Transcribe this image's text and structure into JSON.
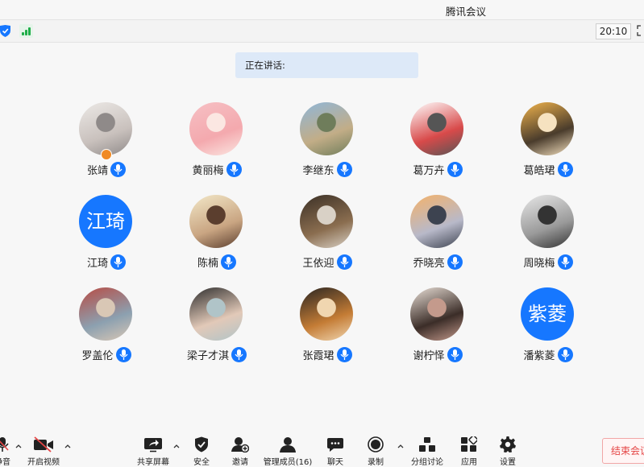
{
  "window": {
    "title": "腾讯会议"
  },
  "status": {
    "clock": "20:10"
  },
  "speaking": {
    "label": "正在讲话:"
  },
  "participants": [
    {
      "name": "张靖",
      "type": "photo",
      "palette": [
        "#ece9e6",
        "#c9c1bd",
        "#8f8a89"
      ],
      "host": true
    },
    {
      "name": "黄丽梅",
      "type": "photo",
      "palette": [
        "#f6c0c4",
        "#f4a9ae",
        "#fbe7e2"
      ]
    },
    {
      "name": "李继东",
      "type": "photo",
      "palette": [
        "#8fb6d8",
        "#c2ad87",
        "#6f7d5b"
      ]
    },
    {
      "name": "葛万卉",
      "type": "photo",
      "palette": [
        "#ffffff",
        "#d84a4a",
        "#555555"
      ]
    },
    {
      "name": "葛皓珺",
      "type": "photo",
      "palette": [
        "#f2b44c",
        "#4a3c2c",
        "#f6e2c0"
      ]
    },
    {
      "name": "江琦",
      "type": "letter",
      "initials": "江琦"
    },
    {
      "name": "陈楠",
      "type": "photo",
      "palette": [
        "#f3e8c8",
        "#c9a582",
        "#5b3e2e"
      ]
    },
    {
      "name": "王依迎",
      "type": "photo",
      "palette": [
        "#3b3026",
        "#8a6d4f",
        "#d9d1c6"
      ]
    },
    {
      "name": "乔晓亮",
      "type": "photo",
      "palette": [
        "#f4b26b",
        "#b8b9c9",
        "#3d4350"
      ]
    },
    {
      "name": "周晓梅",
      "type": "photo",
      "palette": [
        "#e8e8e8",
        "#9a9a9a",
        "#333333"
      ]
    },
    {
      "name": "罗盖伦",
      "type": "photo",
      "palette": [
        "#b84c44",
        "#8ca0b0",
        "#d9c7b5"
      ]
    },
    {
      "name": "梁子才淇",
      "type": "photo",
      "palette": [
        "#2e2e2e",
        "#e2c9b8",
        "#b0c4c8"
      ]
    },
    {
      "name": "张霞珺",
      "type": "photo",
      "palette": [
        "#2a2622",
        "#c47c35",
        "#f0d6b0"
      ]
    },
    {
      "name": "谢柠怿",
      "type": "photo",
      "palette": [
        "#e9dfd6",
        "#3b2d28",
        "#c49a8c"
      ]
    },
    {
      "name": "潘紫菱",
      "type": "letter",
      "initials": "紫菱"
    }
  ],
  "toolbar": {
    "mute": "静音",
    "video": "开启视频",
    "share": "共享屏幕",
    "security": "安全",
    "invite": "邀请",
    "members": "管理成员(16)",
    "chat": "聊天",
    "record": "录制",
    "breakout": "分组讨论",
    "apps": "应用",
    "settings": "设置",
    "end": "结束会议"
  },
  "colors": {
    "accent": "#1677ff",
    "end": "#e54545",
    "signal": "#1fae49"
  }
}
